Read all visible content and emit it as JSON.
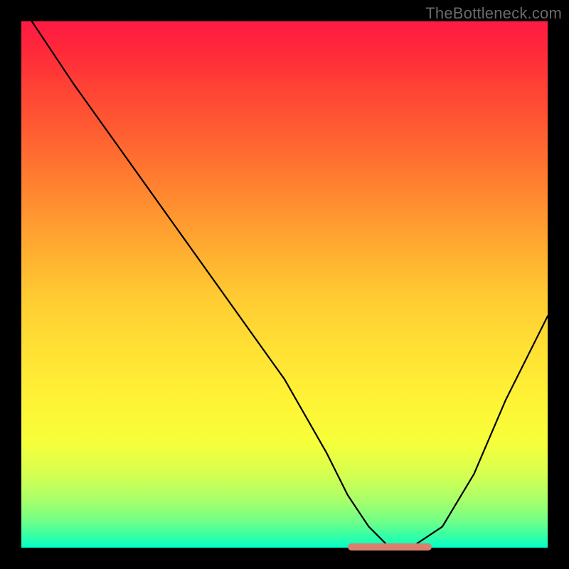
{
  "watermark": "TheBottleneck.com",
  "chart_data": {
    "type": "line",
    "title": "",
    "xlabel": "",
    "ylabel": "",
    "xlim": [
      0,
      100
    ],
    "ylim": [
      0,
      100
    ],
    "grid": false,
    "legend": false,
    "series": [
      {
        "name": "bottleneck-curve",
        "x": [
          2,
          10,
          20,
          30,
          40,
          50,
          58,
          62,
          66,
          70,
          74,
          80,
          86,
          92,
          100
        ],
        "y": [
          100,
          88,
          74,
          60,
          46,
          32,
          18,
          10,
          4,
          0,
          0,
          4,
          14,
          28,
          44
        ]
      }
    ],
    "flat_region": {
      "x_start": 62,
      "x_end": 78,
      "y": 0
    },
    "background_gradient": {
      "top": "#ff1a44",
      "mid": "#ffe034",
      "bottom": "#00ffc8"
    }
  }
}
